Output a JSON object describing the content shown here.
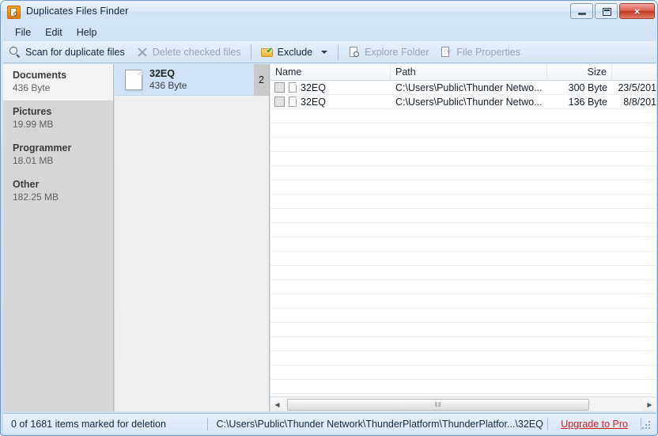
{
  "window": {
    "title": "Duplicates Files Finder",
    "icon": "app-icon",
    "buttons": {
      "minimize": "minimize",
      "maximize": "maximize",
      "close": "×"
    }
  },
  "menubar": {
    "items": [
      {
        "label": "File"
      },
      {
        "label": "Edit"
      },
      {
        "label": "Help"
      }
    ]
  },
  "toolbar": {
    "scan_label": "Scan for duplicate files",
    "scan_icon": "magnifier-icon",
    "delete_label": "Delete checked files",
    "delete_icon": "x-icon",
    "exclude_label": "Exclude",
    "exclude_icon": "folder-check-icon",
    "exclude_caret": "chevron-down-icon",
    "explore_label": "Explore Folder",
    "explore_icon": "explore-folder-icon",
    "properties_label": "File Properties",
    "properties_icon": "file-properties-icon"
  },
  "sidebar": {
    "categories": [
      {
        "name": "Documents",
        "size": "436 Byte",
        "selected": true
      },
      {
        "name": "Pictures",
        "size": "19.99 MB",
        "selected": false
      },
      {
        "name": "Programmer",
        "size": "18.01 MB",
        "selected": false
      },
      {
        "name": "Other",
        "size": "182.25 MB",
        "selected": false
      }
    ]
  },
  "groups": [
    {
      "name": "32EQ",
      "size": "436 Byte",
      "count": "2",
      "icon": "file-icon",
      "selected": true
    }
  ],
  "filelist": {
    "columns": [
      {
        "key": "name",
        "label": "Name"
      },
      {
        "key": "path",
        "label": "Path"
      },
      {
        "key": "size",
        "label": "Size"
      },
      {
        "key": "date",
        "label": ""
      }
    ],
    "rows": [
      {
        "checked": false,
        "name": "32EQ",
        "path": "C:\\Users\\Public\\Thunder Netwo...",
        "size": "300 Byte",
        "date": "23/5/201"
      },
      {
        "checked": false,
        "name": "32EQ",
        "path": "C:\\Users\\Public\\Thunder Netwo...",
        "size": "136 Byte",
        "date": "8/8/201"
      }
    ]
  },
  "scrollbar": {
    "left_arrow": "◀",
    "right_arrow": "▶",
    "grip": "‖‖"
  },
  "statusbar": {
    "marked": "0 of 1681 items marked for deletion",
    "path": "C:\\Users\\Public\\Thunder Network\\ThunderPlatform\\ThunderPlatfor...\\32EQ",
    "upgrade": "Upgrade to Pro"
  },
  "colors": {
    "accent": "#cfe2f7",
    "link": "#d01b1b",
    "app_icon": "#e07b10"
  }
}
